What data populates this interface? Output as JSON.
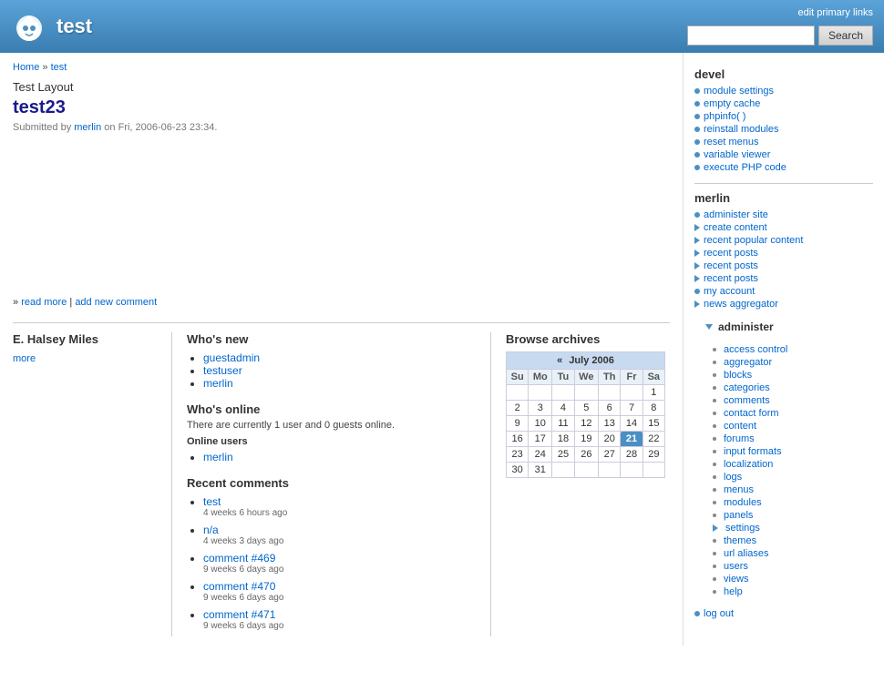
{
  "header": {
    "site_title": "test",
    "edit_primary_links": "edit primary links",
    "search_button": "Search",
    "search_placeholder": ""
  },
  "breadcrumb": {
    "home": "Home",
    "separator": "»",
    "current": "test"
  },
  "content": {
    "page_label": "Test Layout",
    "page_title": "test23",
    "submitted_prefix": "Submitted by",
    "submitted_user": "merlin",
    "submitted_date": "on Fri, 2006-06-23 23:34.",
    "read_more": "read more",
    "separator": "|",
    "add_comment": "add new comment"
  },
  "halsey": {
    "title": "E. Halsey Miles",
    "more": "more"
  },
  "whos_new": {
    "title": "Who's new",
    "users": [
      "guestadmin",
      "testuser",
      "merlin"
    ]
  },
  "whos_online": {
    "title": "Who's online",
    "description": "There are currently 1 user and 0 guests online.",
    "online_users_label": "Online users",
    "users": [
      "merlin"
    ]
  },
  "recent_comments": {
    "title": "Recent comments",
    "items": [
      {
        "label": "test",
        "link": "test",
        "time": "4 weeks 6 hours ago"
      },
      {
        "label": "n/a",
        "link": "n/a",
        "time": "4 weeks 3 days ago"
      },
      {
        "label": "comment #469",
        "link": "comment #469",
        "time": "9 weeks 6 days ago"
      },
      {
        "label": "comment #470",
        "link": "comment #470",
        "time": "9 weeks 6 days ago"
      },
      {
        "label": "comment #471",
        "link": "comment #471",
        "time": "9 weeks 6 days ago"
      }
    ]
  },
  "calendar": {
    "title": "Browse archives",
    "month_nav_prev": "«",
    "month_label": "July 2006",
    "days_of_week": [
      "Su",
      "Mo",
      "Tu",
      "We",
      "Th",
      "Fr",
      "Sa"
    ],
    "weeks": [
      [
        "",
        "",
        "",
        "",
        "",
        "",
        "1"
      ],
      [
        "2",
        "3",
        "4",
        "5",
        "6",
        "7",
        "8"
      ],
      [
        "9",
        "10",
        "11",
        "12",
        "13",
        "14",
        "15"
      ],
      [
        "16",
        "17",
        "18",
        "19",
        "20",
        "21",
        "22"
      ],
      [
        "23",
        "24",
        "25",
        "26",
        "27",
        "28",
        "29"
      ],
      [
        "30",
        "31",
        "",
        "",
        "",
        "",
        ""
      ]
    ],
    "today": "21"
  },
  "sidebar": {
    "devel_title": "devel",
    "devel_items": [
      {
        "label": "module settings",
        "type": "bullet"
      },
      {
        "label": "empty cache",
        "type": "bullet"
      },
      {
        "label": "phpinfo( )",
        "type": "bullet"
      },
      {
        "label": "reinstall modules",
        "type": "bullet"
      },
      {
        "label": "reset menus",
        "type": "bullet"
      },
      {
        "label": "variable viewer",
        "type": "bullet"
      },
      {
        "label": "execute PHP code",
        "type": "bullet"
      }
    ],
    "merlin_title": "merlin",
    "merlin_items": [
      {
        "label": "administer site",
        "type": "bullet"
      },
      {
        "label": "create content",
        "type": "arrow"
      },
      {
        "label": "recent popular content",
        "type": "arrow"
      },
      {
        "label": "recent posts",
        "type": "arrow"
      },
      {
        "label": "recent posts",
        "type": "arrow"
      },
      {
        "label": "recent posts",
        "type": "arrow"
      },
      {
        "label": "my account",
        "type": "bullet"
      },
      {
        "label": "news aggregator",
        "type": "arrow"
      }
    ],
    "administer_title": "administer",
    "administer_items": [
      {
        "label": "access control",
        "type": "small"
      },
      {
        "label": "aggregator",
        "type": "small"
      },
      {
        "label": "blocks",
        "type": "small"
      },
      {
        "label": "categories",
        "type": "small"
      },
      {
        "label": "comments",
        "type": "small"
      },
      {
        "label": "contact form",
        "type": "small"
      },
      {
        "label": "content",
        "type": "small"
      },
      {
        "label": "forums",
        "type": "small"
      },
      {
        "label": "input formats",
        "type": "small"
      },
      {
        "label": "localization",
        "type": "small"
      },
      {
        "label": "logs",
        "type": "small"
      },
      {
        "label": "menus",
        "type": "small"
      },
      {
        "label": "modules",
        "type": "small"
      },
      {
        "label": "panels",
        "type": "small"
      },
      {
        "label": "settings",
        "type": "arrow_right"
      },
      {
        "label": "themes",
        "type": "small"
      },
      {
        "label": "url aliases",
        "type": "small"
      },
      {
        "label": "users",
        "type": "small"
      },
      {
        "label": "views",
        "type": "small"
      },
      {
        "label": "help",
        "type": "small"
      }
    ],
    "log_out": "log out"
  }
}
